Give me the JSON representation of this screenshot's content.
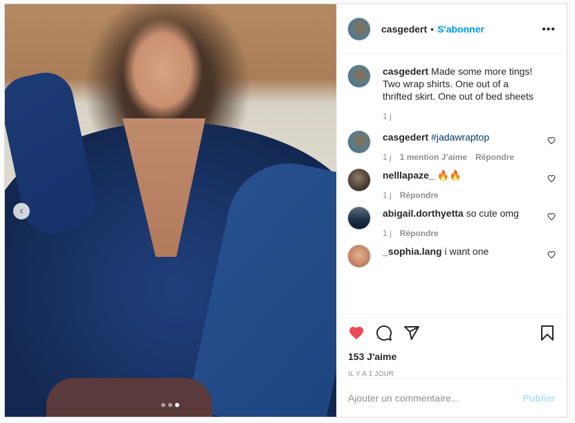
{
  "post": {
    "author": "casgedert",
    "follow_label": "S'abonner",
    "separator": "•",
    "more_label": "•••",
    "carousel": {
      "total": 3,
      "active": 3
    },
    "prev_label": "‹"
  },
  "comments": [
    {
      "user": "casgedert",
      "text": "Made some more tings! Two wrap shirts. One out of a thrifted skirt. One out of bed sheets",
      "tag": "",
      "time": "1 j",
      "likes_label": "",
      "reply_label": "",
      "avatar": "author",
      "show_heart": false
    },
    {
      "user": "casgedert",
      "text": "",
      "tag": "#jadawraptop",
      "time": "1 j",
      "likes_label": "1 mention J’aime",
      "reply_label": "Répondre",
      "avatar": "author",
      "show_heart": true
    },
    {
      "user": "nelllapaze_",
      "text": "🔥🔥",
      "tag": "",
      "time": "1 j",
      "likes_label": "",
      "reply_label": "Répondre",
      "avatar": "nell",
      "show_heart": true
    },
    {
      "user": "abigail.dorthyetta",
      "text": "so cute omg",
      "tag": "",
      "time": "1 j",
      "likes_label": "",
      "reply_label": "Répondre",
      "avatar": "abi",
      "show_heart": true
    },
    {
      "user": "_sophia.lang",
      "text": "i want one",
      "tag": "",
      "time": "",
      "likes_label": "",
      "reply_label": "",
      "avatar": "sophia",
      "show_heart": true
    }
  ],
  "actions": {
    "likes": "153 J'aime",
    "timestamp": "IL Y A 1 JOUR",
    "liked": true,
    "like_color": "#ed4956"
  },
  "add_comment": {
    "placeholder": "Ajouter un commentaire...",
    "publish_label": "Publier"
  },
  "colors": {
    "accent": "#0095f6",
    "text": "#262626",
    "muted": "#8e8e8e",
    "publish_disabled": "#b2dffc"
  },
  "icons": [
    "more-icon",
    "prev-chevron-icon",
    "heart-icon",
    "comment-icon",
    "share-icon",
    "bookmark-icon",
    "comment-like-heart-icon"
  ]
}
